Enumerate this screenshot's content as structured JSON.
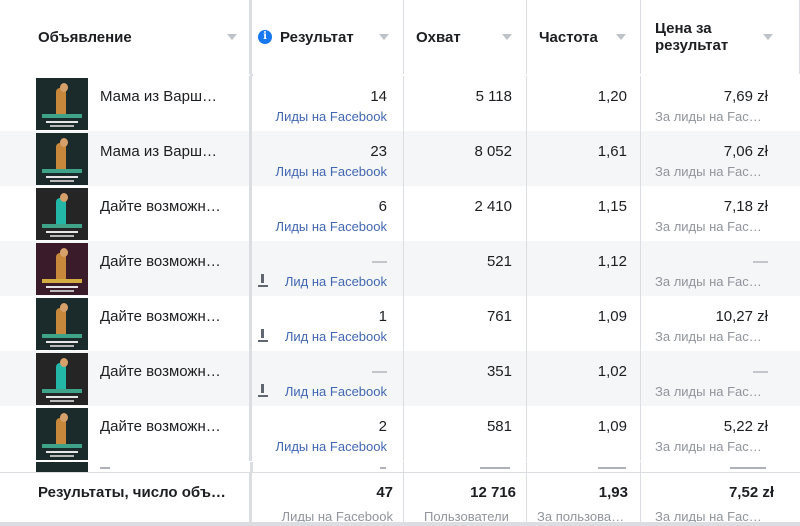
{
  "columns": {
    "ad": "Объявление",
    "result": "Результат",
    "reach": "Охват",
    "frequency": "Частота",
    "cost": "Цена за результат"
  },
  "rows": [
    {
      "name": "Мама из Варш…",
      "result": "14",
      "result_type": "Лиды на Facebook",
      "reach": "5 118",
      "frequency": "1,20",
      "cost": "7,69 zł",
      "cost_type": "За лиды на Fac…"
    },
    {
      "name": "Мама из Варш…",
      "result": "23",
      "result_type": "Лиды на Facebook",
      "reach": "8 052",
      "frequency": "1,61",
      "cost": "7,06 zł",
      "cost_type": "За лиды на Fac…"
    },
    {
      "name": "Дайте возможн…",
      "result": "6",
      "result_type": "Лиды на Facebook",
      "reach": "2 410",
      "frequency": "1,15",
      "cost": "7,18 zł",
      "cost_type": "За лиды на Fac…"
    },
    {
      "name": "Дайте возможн…",
      "result": "—",
      "result_type": "Лид на Facebook",
      "reach": "521",
      "frequency": "1,12",
      "cost": "—",
      "cost_type": "За лиды на Fac…"
    },
    {
      "name": "Дайте возможн…",
      "result": "1",
      "result_type": "Лид на Facebook",
      "reach": "761",
      "frequency": "1,09",
      "cost": "10,27 zł",
      "cost_type": "За лиды на Fac…"
    },
    {
      "name": "Дайте возможн…",
      "result": "—",
      "result_type": "Лид на Facebook",
      "reach": "351",
      "frequency": "1,02",
      "cost": "—",
      "cost_type": "За лиды на Fac…"
    },
    {
      "name": "Дайте возможн…",
      "result": "2",
      "result_type": "Лиды на Facebook",
      "reach": "581",
      "frequency": "1,09",
      "cost": "5,22 zł",
      "cost_type": "За лиды на Fac…"
    }
  ],
  "footer": {
    "label": "Результаты, число объ…",
    "result": "47",
    "result_type": "Лиды на Facebook",
    "reach": "12 716",
    "reach_type": "Пользователи",
    "frequency": "1,93",
    "frequency_type": "За пользова…",
    "cost": "7,52 zł",
    "cost_type": "За лиды на Fac…"
  },
  "icons": {
    "info": "info-icon",
    "sort": "sort-arrow-icon",
    "download": "download-icon"
  },
  "colors": {
    "link": "#4267b2",
    "info": "#1877f2",
    "muted": "#90949c"
  }
}
